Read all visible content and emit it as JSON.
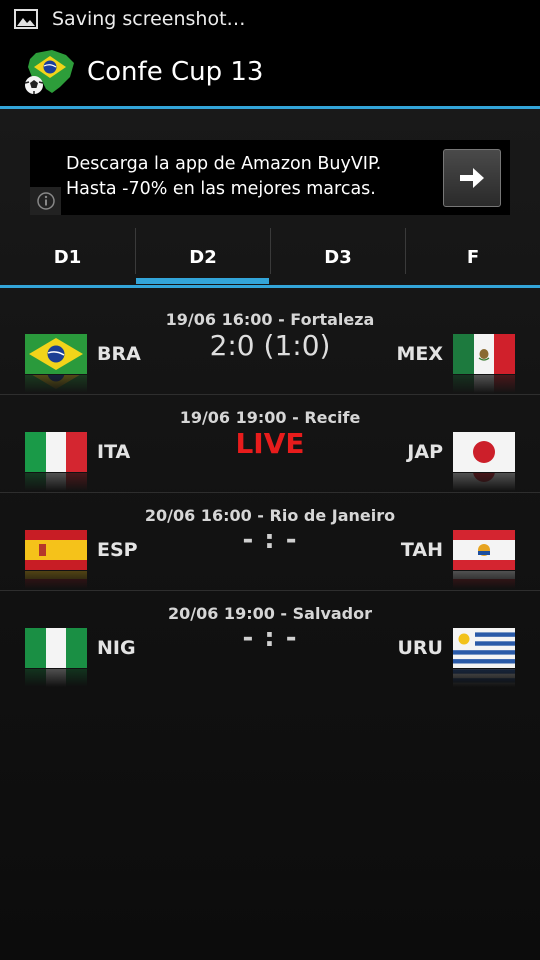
{
  "status_bar": {
    "icon": "image-icon",
    "text": "Saving screenshot…"
  },
  "app": {
    "title": "Confe Cup 13",
    "icon": "brazil-map-ball-icon"
  },
  "ad": {
    "line1": "Descarga la app de Amazon BuyVIP.",
    "line2": "Hasta -70% en las mejores marcas.",
    "info_icon": "info-icon",
    "arrow_icon": "arrow-right-icon"
  },
  "tabs": [
    {
      "label": "D1",
      "selected": false
    },
    {
      "label": "D2",
      "selected": true
    },
    {
      "label": "D3",
      "selected": false
    },
    {
      "label": "F",
      "selected": false
    }
  ],
  "colors": {
    "accent": "#33a5d9",
    "live": "#e81c1c",
    "background": "#151515"
  },
  "matches": [
    {
      "info": "19/06 16:00 - Fortaleza",
      "home": "BRA",
      "away": "MEX",
      "score": "2:0 (1:0)",
      "state": "final",
      "home_flag": "brazil-flag-icon",
      "away_flag": "mexico-flag-icon"
    },
    {
      "info": "19/06 19:00 - Recife",
      "home": "ITA",
      "away": "JAP",
      "score": "LIVE",
      "state": "live",
      "home_flag": "italy-flag-icon",
      "away_flag": "japan-flag-icon"
    },
    {
      "info": "20/06 16:00 - Rio de Janeiro",
      "home": "ESP",
      "away": "TAH",
      "score": "- : -",
      "state": "upcoming",
      "home_flag": "spain-flag-icon",
      "away_flag": "tahiti-flag-icon"
    },
    {
      "info": "20/06 19:00 - Salvador",
      "home": "NIG",
      "away": "URU",
      "score": "- : -",
      "state": "upcoming",
      "home_flag": "nigeria-flag-icon",
      "away_flag": "uruguay-flag-icon"
    }
  ]
}
